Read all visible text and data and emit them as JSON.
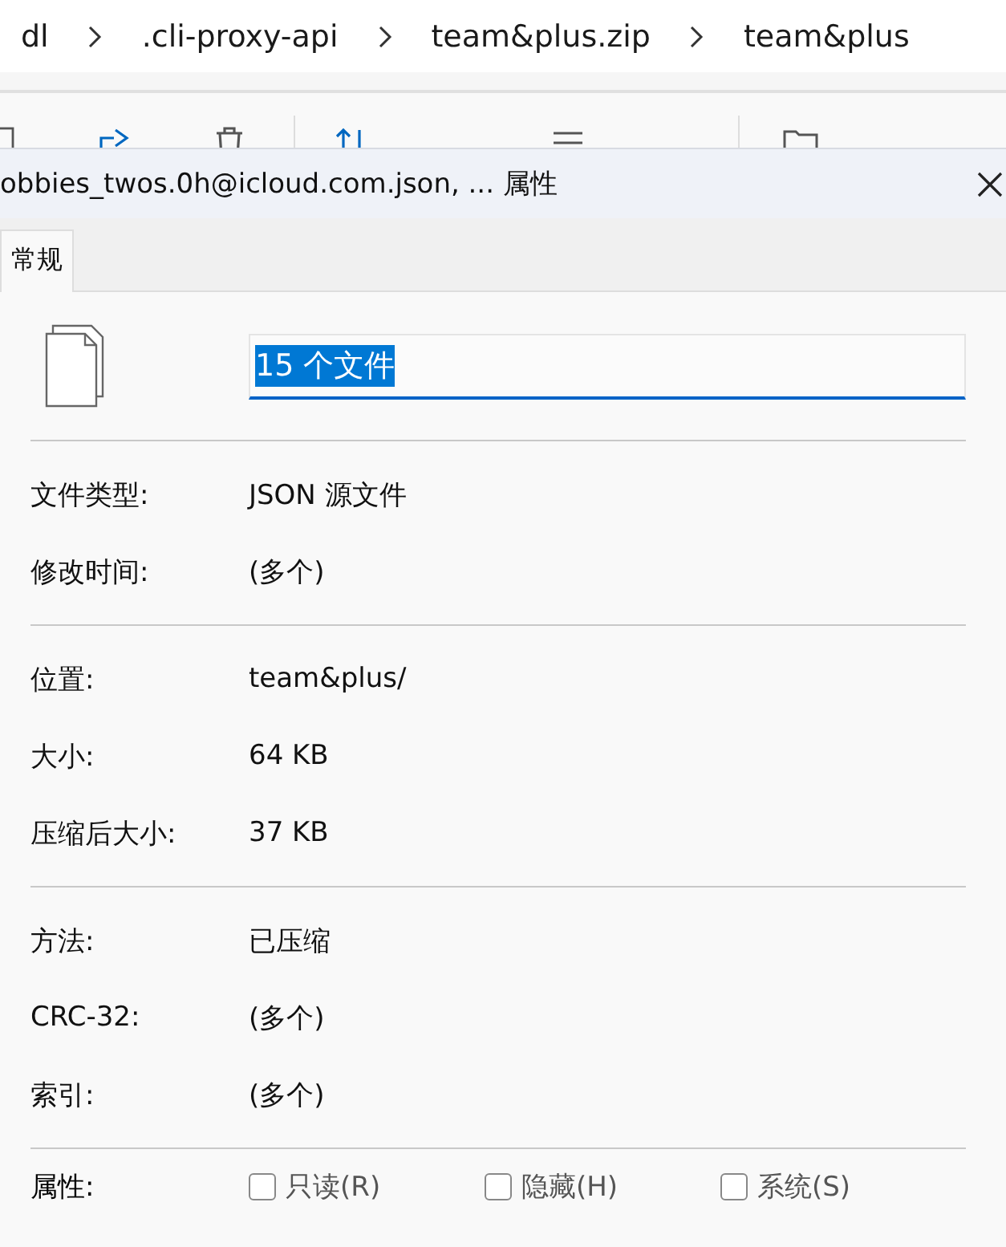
{
  "breadcrumb": [
    "dl",
    ".cli-proxy-api",
    "team&plus.zip",
    "team&plus"
  ],
  "dialog": {
    "title": "obbies_twos.0h@icloud.com.json, ... 属性",
    "tabs": [
      {
        "label": "常规",
        "selected": true
      }
    ],
    "name_field": {
      "value": "15 个文件",
      "selected": true
    },
    "groups": [
      [
        {
          "label": "文件类型:",
          "value": "JSON 源文件"
        },
        {
          "label": "修改时间:",
          "value": "(多个)"
        }
      ],
      [
        {
          "label": "位置:",
          "value": "team&plus/"
        },
        {
          "label": "大小:",
          "value": "64 KB"
        },
        {
          "label": "压缩后大小:",
          "value": "37 KB"
        }
      ],
      [
        {
          "label": "方法:",
          "value": "已压缩"
        },
        {
          "label": "CRC-32:",
          "value": "(多个)"
        },
        {
          "label": "索引:",
          "value": "(多个)"
        }
      ]
    ],
    "attributes": {
      "label": "属性:",
      "options": [
        {
          "label": "只读(R)",
          "checked": false
        },
        {
          "label": "隐藏(H)",
          "checked": false
        },
        {
          "label": "系统(S)",
          "checked": false
        }
      ]
    }
  }
}
